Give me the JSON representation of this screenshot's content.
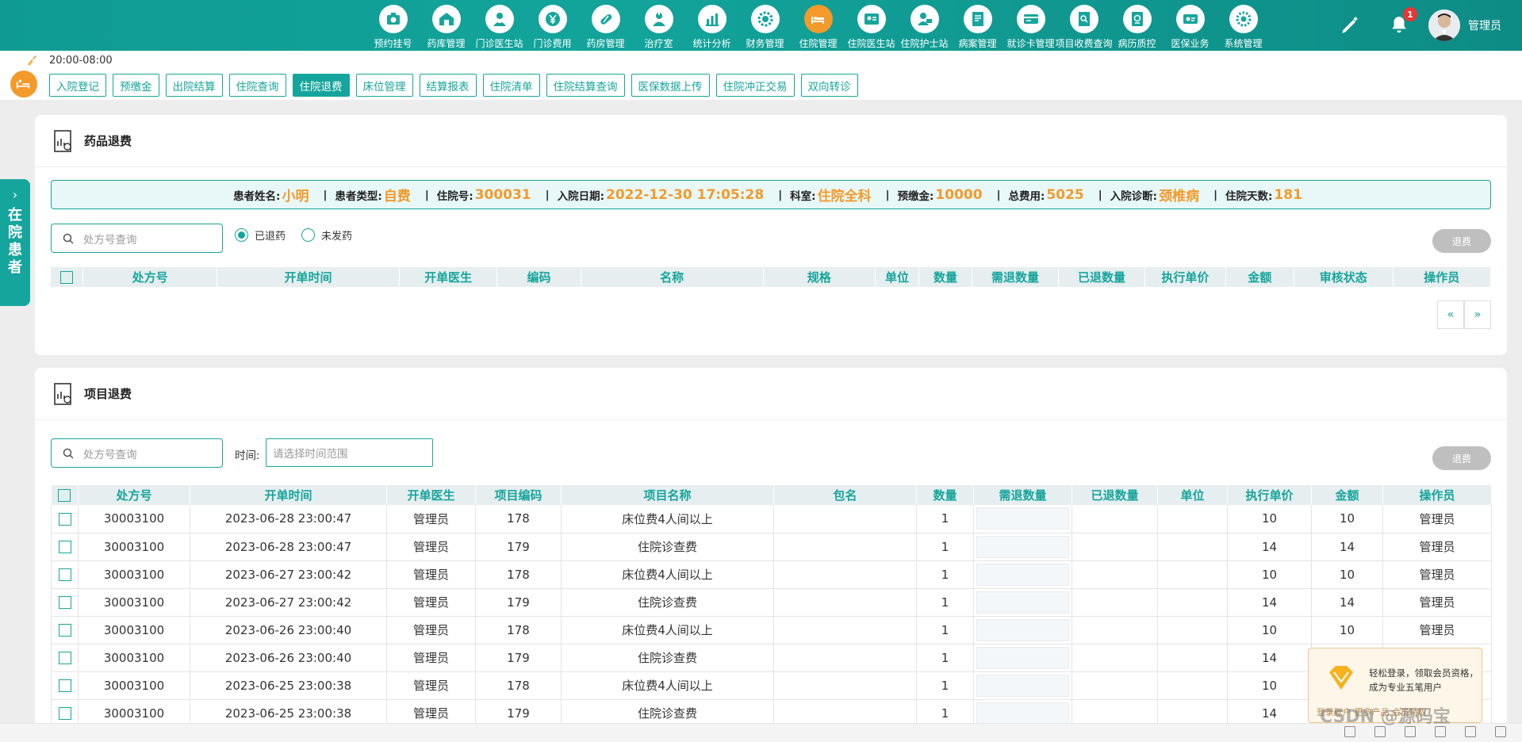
{
  "nav": {
    "items": [
      {
        "label": "预约挂号",
        "icon": "camera-icon"
      },
      {
        "label": "药库管理",
        "icon": "warehouse-icon"
      },
      {
        "label": "门诊医生站",
        "icon": "doctor-icon"
      },
      {
        "label": "门诊费用",
        "icon": "yen-icon"
      },
      {
        "label": "药房管理",
        "icon": "pill-icon"
      },
      {
        "label": "治疗室",
        "icon": "nurse-icon"
      },
      {
        "label": "统计分析",
        "icon": "bar-chart-icon"
      },
      {
        "label": "财务管理",
        "icon": "gear-money-icon"
      },
      {
        "label": "住院管理",
        "icon": "hospital-bed-icon"
      },
      {
        "label": "住院医生站",
        "icon": "doctor-card-icon"
      },
      {
        "label": "住院护士站",
        "icon": "nurse-card-icon"
      },
      {
        "label": "病案管理",
        "icon": "archive-icon"
      },
      {
        "label": "就诊卡管理",
        "icon": "card-icon"
      },
      {
        "label": "项目收费查询",
        "icon": "search-doc-icon"
      },
      {
        "label": "病历质控",
        "icon": "record-icon"
      },
      {
        "label": "医保业务",
        "icon": "insurance-card-icon"
      },
      {
        "label": "系统管理",
        "icon": "settings-icon"
      }
    ],
    "active_index": 8,
    "notification_count": "1",
    "username": "管理员"
  },
  "subbar": {
    "time": "20:00-08:00",
    "tabs": [
      "入院登记",
      "预缴金",
      "出院结算",
      "住院查询",
      "住院退费",
      "床位管理",
      "结算报表",
      "住院清单",
      "住院结算查询",
      "医保数据上传",
      "住院冲正交易",
      "双向转诊"
    ],
    "active_tab": 4
  },
  "side_tab": {
    "label": [
      "在",
      "院",
      "患",
      "者"
    ]
  },
  "drug_refund": {
    "title": "药品退费",
    "patient": {
      "name_label": "患者姓名:",
      "name": "小明",
      "type_label": "患者类型:",
      "type": "自费",
      "id_label": "住院号:",
      "id": "300031",
      "date_label": "入院日期:",
      "date": "2022-12-30 17:05:28",
      "dept_label": "科室:",
      "dept": "住院全科",
      "deposit_label": "预缴金:",
      "deposit": "10000",
      "total_label": "总费用:",
      "total": "5025",
      "diag_label": "入院诊断:",
      "diag": "颈椎病",
      "days_label": "住院天数:",
      "days": "181"
    },
    "search_placeholder": "处方号查询",
    "radio_refunded": "已退药",
    "radio_not_dispensed": "未发药",
    "refund_button": "退费",
    "columns": [
      "处方号",
      "开单时间",
      "开单医生",
      "编码",
      "名称",
      "规格",
      "单位",
      "数量",
      "需退数量",
      "已退数量",
      "执行单价",
      "金额",
      "审核状态",
      "操作员"
    ],
    "pager_prev": "«",
    "pager_next": "»"
  },
  "item_refund": {
    "title": "项目退费",
    "search_placeholder": "处方号查询",
    "time_label": "时间:",
    "time_placeholder": "请选择时间范围",
    "refund_button": "退费",
    "columns": [
      "处方号",
      "开单时间",
      "开单医生",
      "项目编码",
      "项目名称",
      "包名",
      "数量",
      "需退数量",
      "已退数量",
      "单位",
      "执行单价",
      "金额",
      "操作员"
    ],
    "rows": [
      [
        "30003100",
        "2023-06-28 23:00:47",
        "管理员",
        "178",
        "床位费4人间以上",
        "",
        "1",
        "",
        "",
        "",
        "10",
        "10",
        "管理员"
      ],
      [
        "30003100",
        "2023-06-28 23:00:47",
        "管理员",
        "179",
        "住院诊查费",
        "",
        "1",
        "",
        "",
        "",
        "14",
        "14",
        "管理员"
      ],
      [
        "30003100",
        "2023-06-27 23:00:42",
        "管理员",
        "178",
        "床位费4人间以上",
        "",
        "1",
        "",
        "",
        "",
        "10",
        "10",
        "管理员"
      ],
      [
        "30003100",
        "2023-06-27 23:00:42",
        "管理员",
        "179",
        "住院诊查费",
        "",
        "1",
        "",
        "",
        "",
        "14",
        "14",
        "管理员"
      ],
      [
        "30003100",
        "2023-06-26 23:00:40",
        "管理员",
        "178",
        "床位费4人间以上",
        "",
        "1",
        "",
        "",
        "",
        "10",
        "10",
        "管理员"
      ],
      [
        "30003100",
        "2023-06-26 23:00:40",
        "管理员",
        "179",
        "住院诊查费",
        "",
        "1",
        "",
        "",
        "",
        "14",
        "",
        ""
      ],
      [
        "30003100",
        "2023-06-25 23:00:38",
        "管理员",
        "178",
        "床位费4人间以上",
        "",
        "1",
        "",
        "",
        "",
        "10",
        "",
        ""
      ],
      [
        "30003100",
        "2023-06-25 23:00:38",
        "管理员",
        "179",
        "住院诊查费",
        "",
        "1",
        "",
        "",
        "",
        "14",
        "",
        ""
      ]
    ]
  },
  "promo": {
    "line1": "轻松登录，领取会员资格，成为专业五笔用户",
    "line2": "登录账户   更多产品   会员特权"
  },
  "watermark": "CSDN @源码宝",
  "colors": {
    "primary": "#16a59c",
    "accent": "#f39a2a",
    "disabled": "#bfbfbf"
  }
}
